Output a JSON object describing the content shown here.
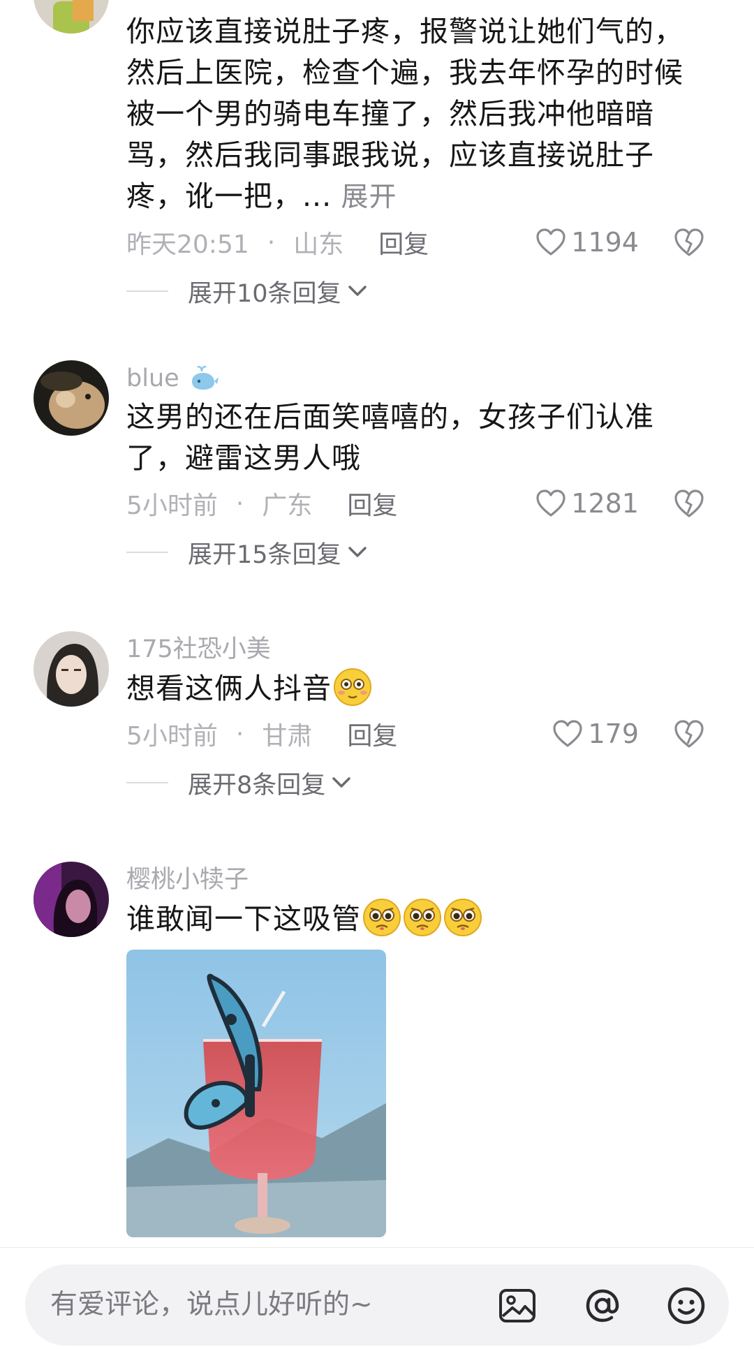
{
  "comments": [
    {
      "username": "",
      "text": "你应该直接说肚子疼，报警说让她们气的，然后上医院，检查个遍，我去年怀孕的时候被一个男的骑电车撞了，然后我冲他暗暗骂，然后我同事跟我说，应该直接说肚子疼，讹一把，...",
      "more": "展开",
      "time": "昨天20:51",
      "location": "山东",
      "reply": "回复",
      "likes": "1194",
      "expand": "展开10条回复"
    },
    {
      "username": "blue",
      "text": "这男的还在后面笑嘻嘻的，女孩子们认准了，避雷这男人哦",
      "time": "5小时前",
      "location": "广东",
      "reply": "回复",
      "likes": "1281",
      "expand": "展开15条回复"
    },
    {
      "username": "175社恐小美",
      "text": "想看这俩人抖音",
      "time": "5小时前",
      "location": "甘肃",
      "reply": "回复",
      "likes": "179",
      "expand": "展开8条回复"
    },
    {
      "username": "樱桃小犊子",
      "text": "谁敢闻一下这吸管"
    }
  ],
  "input": {
    "placeholder": "有爱评论，说点儿好听的~"
  },
  "colors": {
    "meta": "#b0b0b6",
    "text": "#161616",
    "input_bg": "#f2f2f4"
  },
  "icons": [
    "heart-icon",
    "broken-heart-icon",
    "chevron-down-icon",
    "image-icon",
    "at-icon",
    "emoji-icon",
    "whale-badge-icon"
  ]
}
